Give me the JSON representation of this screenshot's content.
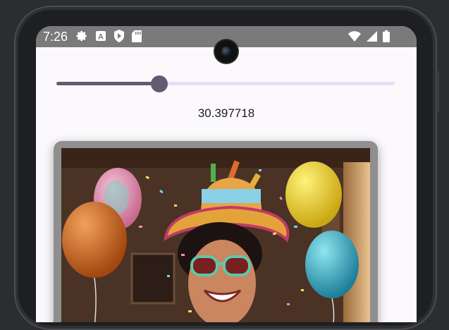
{
  "status_bar": {
    "time": "7:26",
    "left_icons": [
      "gear-icon",
      "a-box-icon",
      "play-shield-icon",
      "sd-card-icon"
    ],
    "right_icons": [
      "wifi-icon",
      "signal-icon",
      "battery-icon"
    ]
  },
  "slider": {
    "value_fraction": 0.304,
    "colors": {
      "active": "#625b71",
      "inactive": "#e8def8"
    }
  },
  "value_text": "30.397718",
  "image": {
    "description_icon": "birthday-photo"
  },
  "colors": {
    "screen_bg": "#fbf9fc",
    "status_bar_bg": "#7a7a7a",
    "card_frame": "#8f8f8f"
  }
}
